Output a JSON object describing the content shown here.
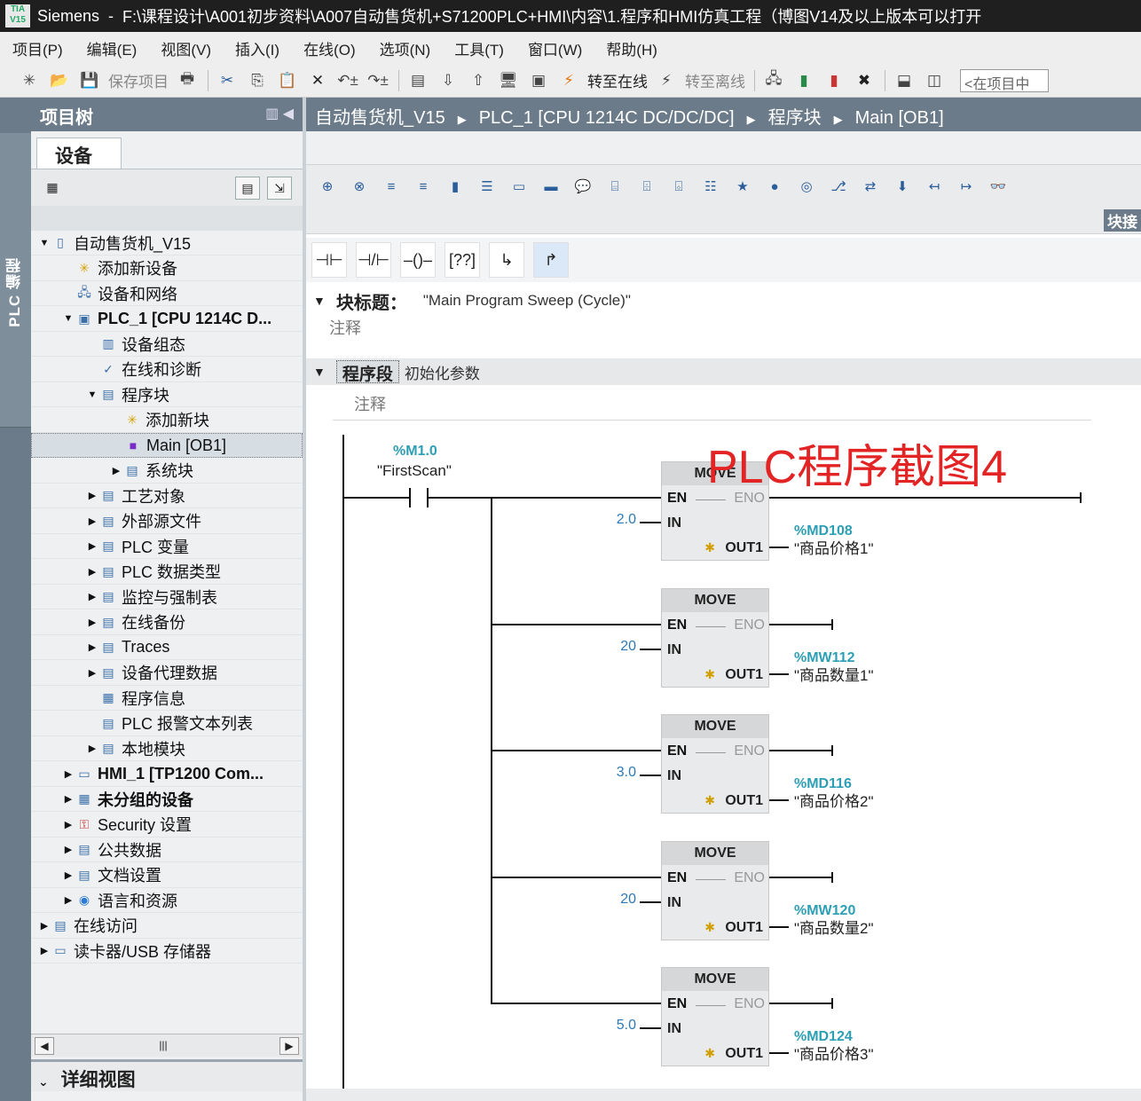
{
  "titlebar": {
    "app": "Siemens",
    "sep": "-",
    "path": "F:\\课程设计\\A001初步资料\\A007自动售货机+S71200PLC+HMI\\内容\\1.程序和HMI仿真工程（博图V14及以上版本可以打开"
  },
  "menu": [
    "项目(P)",
    "编辑(E)",
    "视图(V)",
    "插入(I)",
    "在线(O)",
    "选项(N)",
    "工具(T)",
    "窗口(W)",
    "帮助(H)"
  ],
  "toolbar": {
    "save_project": "保存项目",
    "go_online": "转至在线",
    "go_offline": "转至离线",
    "search_placeholder": "<在项目中"
  },
  "vertical_tab": "PLC 编程",
  "project_tree": {
    "title": "项目树",
    "devices_tab": "设备",
    "items": [
      {
        "label": "自动售货机_V15",
        "level": 0,
        "expand": "open",
        "icon": "project-icon"
      },
      {
        "label": "添加新设备",
        "level": 1,
        "expand": "none",
        "icon": "add-device-icon"
      },
      {
        "label": "设备和网络",
        "level": 1,
        "expand": "none",
        "icon": "network-icon"
      },
      {
        "label": "PLC_1 [CPU 1214C D...",
        "level": 1,
        "expand": "open",
        "icon": "plc-icon",
        "bold": true
      },
      {
        "label": "设备组态",
        "level": 2,
        "expand": "none",
        "icon": "device-config-icon"
      },
      {
        "label": "在线和诊断",
        "level": 2,
        "expand": "none",
        "icon": "diagnostics-icon"
      },
      {
        "label": "程序块",
        "level": 2,
        "expand": "open",
        "icon": "folder-icon"
      },
      {
        "label": "添加新块",
        "level": 3,
        "expand": "none",
        "icon": "add-block-icon"
      },
      {
        "label": "Main [OB1]",
        "level": 3,
        "expand": "none",
        "icon": "ob-icon",
        "selected": true
      },
      {
        "label": "系统块",
        "level": 3,
        "expand": "closed",
        "icon": "folder-icon"
      },
      {
        "label": "工艺对象",
        "level": 2,
        "expand": "closed",
        "icon": "folder-icon"
      },
      {
        "label": "外部源文件",
        "level": 2,
        "expand": "closed",
        "icon": "folder-icon"
      },
      {
        "label": "PLC 变量",
        "level": 2,
        "expand": "closed",
        "icon": "folder-icon"
      },
      {
        "label": "PLC 数据类型",
        "level": 2,
        "expand": "closed",
        "icon": "folder-icon"
      },
      {
        "label": "监控与强制表",
        "level": 2,
        "expand": "closed",
        "icon": "folder-icon"
      },
      {
        "label": "在线备份",
        "level": 2,
        "expand": "closed",
        "icon": "folder-icon"
      },
      {
        "label": "Traces",
        "level": 2,
        "expand": "closed",
        "icon": "folder-icon"
      },
      {
        "label": "设备代理数据",
        "level": 2,
        "expand": "closed",
        "icon": "folder-icon"
      },
      {
        "label": "程序信息",
        "level": 2,
        "expand": "none",
        "icon": "program-info-icon"
      },
      {
        "label": "PLC 报警文本列表",
        "level": 2,
        "expand": "none",
        "icon": "text-list-icon"
      },
      {
        "label": "本地模块",
        "level": 2,
        "expand": "closed",
        "icon": "folder-icon"
      },
      {
        "label": "HMI_1 [TP1200 Com...",
        "level": 1,
        "expand": "closed",
        "icon": "hmi-icon",
        "bold": true
      },
      {
        "label": "未分组的设备",
        "level": 1,
        "expand": "closed",
        "icon": "devices-icon",
        "bold": true
      },
      {
        "label": "Security 设置",
        "level": 1,
        "expand": "closed",
        "icon": "security-icon"
      },
      {
        "label": "公共数据",
        "level": 1,
        "expand": "closed",
        "icon": "common-data-icon"
      },
      {
        "label": "文档设置",
        "level": 1,
        "expand": "closed",
        "icon": "document-icon"
      },
      {
        "label": "语言和资源",
        "level": 1,
        "expand": "closed",
        "icon": "language-icon"
      },
      {
        "label": "在线访问",
        "level": 0,
        "expand": "closed",
        "icon": "online-access-icon"
      },
      {
        "label": "读卡器/USB 存储器",
        "level": 0,
        "expand": "closed",
        "icon": "usb-icon"
      }
    ],
    "detail_view": "详细视图"
  },
  "editor": {
    "breadcrumb": [
      "自动售货机_V15",
      "PLC_1 [CPU 1214C DC/DC/DC]",
      "程序块",
      "Main [OB1]"
    ],
    "block_interface": "块接",
    "block_title_label": "块标题：",
    "block_title_value": "\"Main Program Sweep (Cycle)\"",
    "comment": "注释",
    "network_label": "程序段",
    "network_title": "初始化参数",
    "network_comment": "注释",
    "watermark": "PLC程序截图4"
  },
  "ladder": {
    "contact": {
      "address": "%M1.0",
      "name": "\"FirstScan\""
    },
    "move_label": "MOVE",
    "en": "EN",
    "eno": "ENO",
    "in": "IN",
    "out": "OUT1",
    "boxes": [
      {
        "in_value": "2.0",
        "out_address": "%MD108",
        "out_name": "\"商品价格1\""
      },
      {
        "in_value": "20",
        "out_address": "%MW112",
        "out_name": "\"商品数量1\""
      },
      {
        "in_value": "3.0",
        "out_address": "%MD116",
        "out_name": "\"商品价格2\""
      },
      {
        "in_value": "20",
        "out_address": "%MW120",
        "out_name": "\"商品数量2\""
      },
      {
        "in_value": "5.0",
        "out_address": "%MD124",
        "out_name": "\"商品价格3\""
      }
    ]
  }
}
